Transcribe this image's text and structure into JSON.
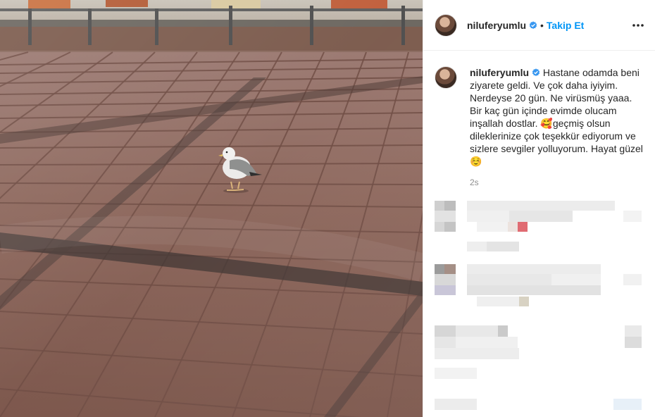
{
  "post": {
    "username": "niluferyumlu",
    "follow_label": "Takip Et",
    "separator": "•",
    "caption_username": "niluferyumlu",
    "caption_text": "Hastane odamda beni ziyarete geldi. Ve çok daha iyiyim. Nerdeyse 20 gün. Ne virüsmüş yaaa. Bir kaç gün içinde evimde olucam inşallah dostlar. 🥰geçmiş olsun dileklerinize çok teşekkür ediyorum ve sizlere sevgiler yolluyorum. Hayat güzel☺️",
    "timestamp": "2s"
  },
  "colors": {
    "accent": "#0095f6",
    "verified": "#3897f0",
    "text": "#262626",
    "muted": "#8e8e8e"
  },
  "icons": {
    "verified": "verified-badge-icon",
    "more": "more-options-icon"
  }
}
